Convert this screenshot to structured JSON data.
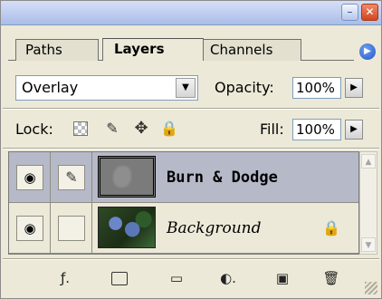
{
  "window": {
    "minimize_glyph": "–",
    "close_glyph": "✕"
  },
  "tabs": [
    {
      "label": "Paths"
    },
    {
      "label": "Layers"
    },
    {
      "label": "Channels"
    }
  ],
  "panel_menu_glyph": "▶",
  "blend": {
    "mode": "Overlay",
    "arrow_glyph": "▼",
    "opacity_label": "Opacity:",
    "opacity_value": "100%",
    "slider_glyph": "▶"
  },
  "lock": {
    "label": "Lock:",
    "fill_label": "Fill:",
    "fill_value": "100%",
    "slider_glyph": "▶"
  },
  "layers": [
    {
      "name": "Burn & Dodge",
      "selected": true
    },
    {
      "name": "Background",
      "selected": false
    }
  ],
  "icons": {
    "eye": "◉",
    "brush": "✎",
    "move": "✥",
    "lock": "🔒",
    "style": "ƒ.",
    "folder": "▭",
    "adjust": "◐.",
    "new_layer": "▣",
    "trash": "🗑",
    "up_arrow": "▲",
    "down_arrow": "▼"
  },
  "colors": {
    "selected_row": "#b6b9c8",
    "panel_bg": "#ece9d8",
    "close_button": "#d2461f"
  }
}
